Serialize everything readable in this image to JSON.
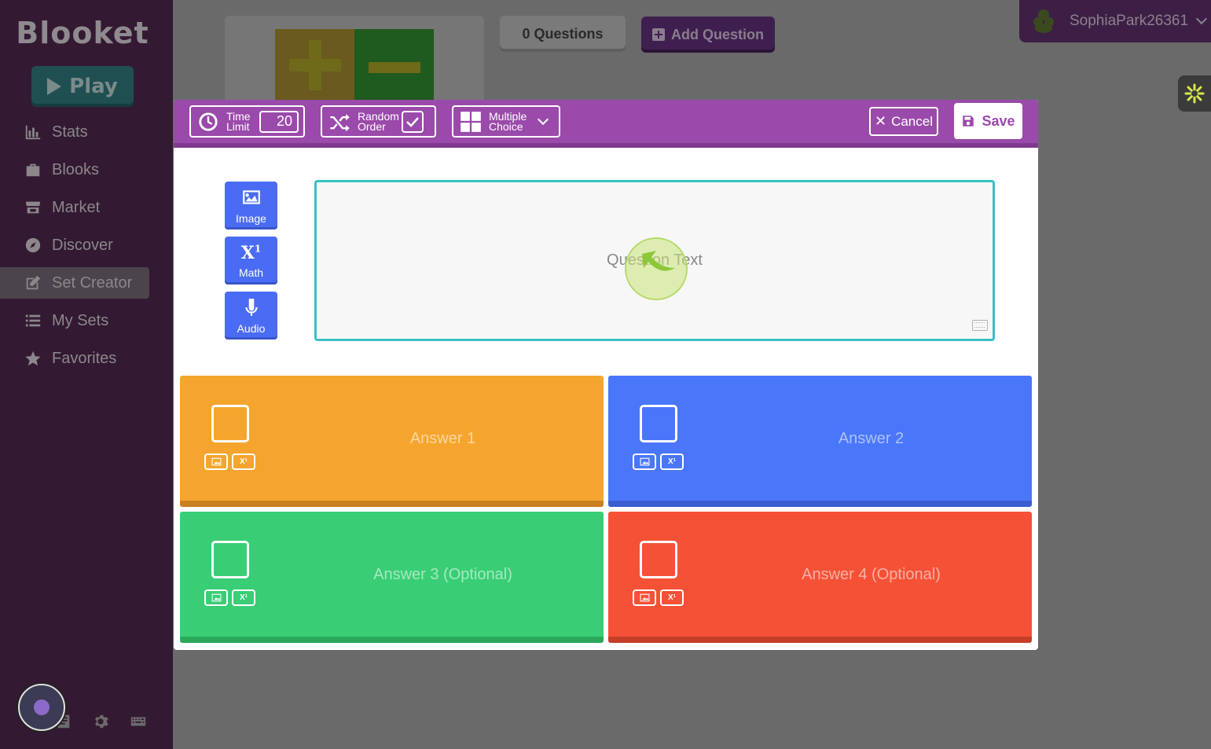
{
  "sidebar": {
    "logo": "Blooket",
    "play_label": "Play",
    "items": [
      {
        "label": "Stats",
        "icon": "bar-chart-icon"
      },
      {
        "label": "Blooks",
        "icon": "briefcase-icon"
      },
      {
        "label": "Market",
        "icon": "store-icon"
      },
      {
        "label": "Discover",
        "icon": "compass-icon"
      },
      {
        "label": "Set Creator",
        "icon": "edit-icon",
        "active": true
      },
      {
        "label": "My Sets",
        "icon": "list-icon"
      },
      {
        "label": "Favorites",
        "icon": "star-icon"
      }
    ]
  },
  "header": {
    "question_count": "0 Questions",
    "add_question": "Add Question",
    "username": "SophiaPark26361"
  },
  "modal": {
    "time_limit_label": "Time Limit",
    "time_limit_value": "20",
    "random_order_label": "Random Order",
    "random_order_checked": true,
    "question_type_label": "Multiple Choice",
    "cancel_label": "Cancel",
    "save_label": "Save",
    "tools": [
      {
        "label": "Image",
        "icon": "image-icon"
      },
      {
        "label": "Math",
        "icon": "math-icon"
      },
      {
        "label": "Audio",
        "icon": "microphone-icon"
      }
    ],
    "question_placeholder": "Question Text",
    "answers": [
      {
        "label": "Answer 1",
        "color": "#f5a52e"
      },
      {
        "label": "Answer 2",
        "color": "#4a76fa"
      },
      {
        "label": "Answer 3 (Optional)",
        "color": "#39ce75"
      },
      {
        "label": "Answer 4 (Optional)",
        "color": "#f55136"
      }
    ]
  },
  "colors": {
    "brand_purple": "#9a4aaa",
    "question_border": "#3bbfc7",
    "tool_blue": "#4a6cf4"
  }
}
